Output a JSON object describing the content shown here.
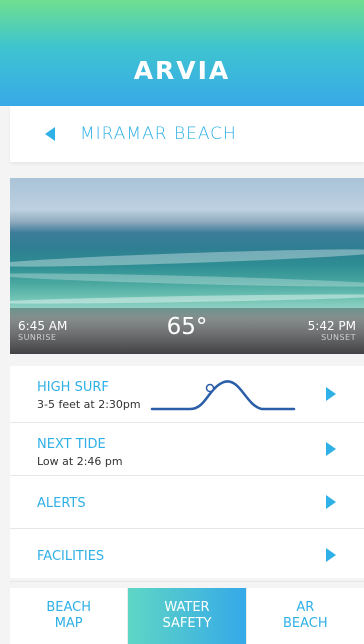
{
  "app": {
    "title": "ARVIA"
  },
  "location": {
    "name": "MIRAMAR BEACH"
  },
  "weather": {
    "sunrise_time": "6:45 AM",
    "sunrise_label": "SUNRISE",
    "temperature": "65°",
    "sunset_time": "5:42 PM",
    "sunset_label": "SUNSET"
  },
  "info_rows": [
    {
      "title": "HIGH SURF",
      "subtitle": "3-5 feet at 2:30pm"
    },
    {
      "title": "NEXT TIDE",
      "subtitle": "Low at 2:46 pm"
    },
    {
      "title": "ALERTS"
    },
    {
      "title": "FACILITIES"
    }
  ],
  "bottom_nav": [
    {
      "line1": "BEACH",
      "line2": "MAP",
      "active": false
    },
    {
      "line1": "WATER",
      "line2": "SAFETY",
      "active": true
    },
    {
      "line1": "AR",
      "line2": "BEACH",
      "active": false
    }
  ],
  "colors": {
    "accent": "#2fb0e6",
    "surf_curve": "#2a5ea8",
    "header_gradient_top": "#6fdf8f",
    "header_gradient_bottom": "#38a9e8"
  },
  "icons": {
    "back": "triangle-left-icon",
    "row_arrow": "triangle-right-icon"
  }
}
